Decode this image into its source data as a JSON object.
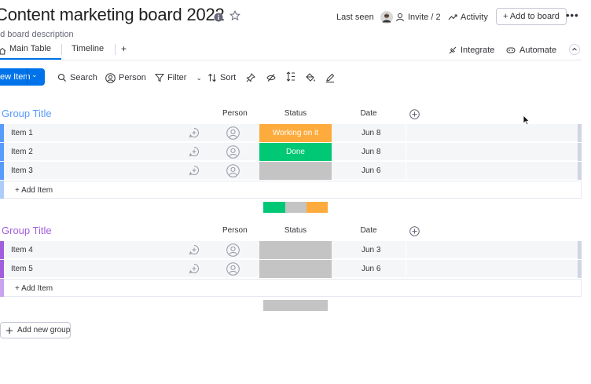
{
  "board": {
    "title": "Content marketing board 2022",
    "description": "dd board description"
  },
  "header": {
    "last_seen_label": "Last seen",
    "invite_label": "Invite / 2",
    "activity_label": "Activity",
    "add_to_board_label": "+ Add to board",
    "more_label": "•••"
  },
  "tabs": [
    {
      "label": "Main Table",
      "active": true
    },
    {
      "label": "Timeline",
      "active": false
    }
  ],
  "tabs_add": "+",
  "integrations": {
    "integrate_label": "Integrate",
    "automate_label": "Automate"
  },
  "toolbar": {
    "new_item_label": "ew Item",
    "search_label": "Search",
    "person_label": "Person",
    "filter_label": "Filter",
    "sort_label": "Sort"
  },
  "columns": {
    "person": "Person",
    "status": "Status",
    "date": "Date"
  },
  "groups": [
    {
      "title": "Group Title",
      "color": "#579bfc",
      "add_item_label": "+ Add Item",
      "items": [
        {
          "name": "Item 1",
          "status": "Working on it",
          "status_color": "#fdab3d",
          "date": "Jun 8"
        },
        {
          "name": "Item 2",
          "status": "Done",
          "status_color": "#00c875",
          "date": "Jun 8"
        },
        {
          "name": "Item 3",
          "status": "",
          "status_color": "#c4c4c4",
          "date": "Jun 6"
        }
      ],
      "summary": [
        {
          "color": "#00c875",
          "fraction": 0.333
        },
        {
          "color": "#c4c4c4",
          "fraction": 0.333
        },
        {
          "color": "#fdab3d",
          "fraction": 0.334
        }
      ]
    },
    {
      "title": "Group Title",
      "color": "#a25ddc",
      "add_item_label": "+ Add Item",
      "items": [
        {
          "name": "Item 4",
          "status": "",
          "status_color": "#c4c4c4",
          "date": "Jun 3"
        },
        {
          "name": "Item 5",
          "status": "",
          "status_color": "#c4c4c4",
          "date": "Jun 6"
        }
      ],
      "summary": [
        {
          "color": "#c4c4c4",
          "fraction": 1.0
        }
      ]
    }
  ],
  "add_new_group_label": "Add new group",
  "icons": [
    "info-icon",
    "star-icon",
    "user-avatar",
    "invite-person-icon",
    "activity-icon",
    "home-icon",
    "integrate-icon",
    "automate-icon",
    "collapse-icon",
    "search-icon",
    "person-circle-icon",
    "filter-icon",
    "sort-icon",
    "pin-icon",
    "hide-icon",
    "row-height-icon",
    "paint-bucket-icon",
    "pen-icon",
    "add-column-icon",
    "add-update-icon",
    "empty-person-icon",
    "cursor-icon"
  ],
  "colors": {
    "primary": "#0073ea",
    "working": "#fdab3d",
    "done": "#00c875",
    "empty_status": "#c4c4c4",
    "group1": "#579bfc",
    "group2": "#a25ddc"
  }
}
